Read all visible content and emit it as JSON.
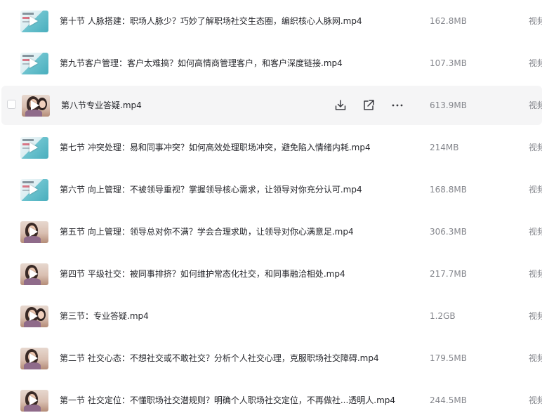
{
  "files": [
    {
      "name": "第十节 人脉搭建：职场人脉少？巧妙了解职场社交生态圈，编织核心人脉网.mp4",
      "size": "162.8MB",
      "type": "视频",
      "thumb": "poster"
    },
    {
      "name": "第九节客户管理：客户太难搞？如何高情商管理客户，和客户深度链接.mp4",
      "size": "107.3MB",
      "type": "视频",
      "thumb": "poster"
    },
    {
      "name": "第八节专业答疑.mp4",
      "size": "613.9MB",
      "type": "视频",
      "thumb": "person-two"
    },
    {
      "name": "第七节 冲突处理：易和同事冲突？如何高效处理职场冲突，避免陷入情绪内耗.mp4",
      "size": "214MB",
      "type": "视频",
      "thumb": "poster"
    },
    {
      "name": "第六节 向上管理：不被领导重视？掌握领导核心需求，让领导对你充分认可.mp4",
      "size": "168.8MB",
      "type": "视频",
      "thumb": "poster"
    },
    {
      "name": "第五节 向上管理：领导总对你不满？学会合理求助，让领导对你心满意足.mp4",
      "size": "306.3MB",
      "type": "视频",
      "thumb": "person"
    },
    {
      "name": "第四节 平级社交：被同事排挤？如何维护常态化社交，和同事融洽相处.mp4",
      "size": "217.7MB",
      "type": "视频",
      "thumb": "person"
    },
    {
      "name": "第三节：专业答疑.mp4",
      "size": "1.2GB",
      "type": "视频",
      "thumb": "person-two"
    },
    {
      "name": "第二节 社交心态：不想社交或不敢社交？分析个人社交心理，克服职场社交障碍.mp4",
      "size": "179.5MB",
      "type": "视频",
      "thumb": "person"
    },
    {
      "name": "第一节 社交定位：不懂职场社交潜规则？明确个人职场社交定位，不再做社...透明人.mp4",
      "size": "244.5MB",
      "type": "视频",
      "thumb": "person"
    }
  ],
  "hover_row_index": 2,
  "hover_actions": [
    "download-icon",
    "share-icon",
    "more-icon"
  ],
  "colors": {
    "hover_bg": "#f5f5f6",
    "text_primary": "#25262b",
    "text_secondary": "#84868c"
  }
}
